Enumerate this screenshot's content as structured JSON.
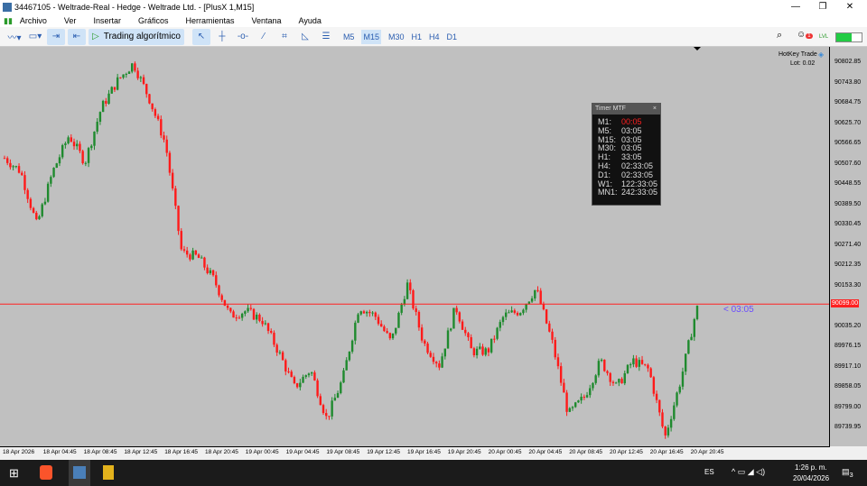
{
  "window": {
    "title": "34467105 - Weltrade-Real - Hedge - Weltrade Ltd. - [PlusX 1,M15]"
  },
  "menu": [
    "Archivo",
    "Ver",
    "Insertar",
    "Gráficos",
    "Herramientas",
    "Ventana",
    "Ayuda"
  ],
  "toolbar": {
    "algo_label": "Trading algorítmico",
    "timeframes": [
      "M5",
      "M15",
      "M30",
      "H1",
      "H4",
      "D1"
    ],
    "selected_timeframe": "M15",
    "notification_count": "1",
    "level_label": "LVL"
  },
  "hotkey": {
    "title": "HotKey Trade",
    "lot": "Lot: 0.02"
  },
  "timer": {
    "title": "Timer MTF",
    "close": "×",
    "rows": [
      [
        "M1:",
        "00:05"
      ],
      [
        "M5:",
        "03:05"
      ],
      [
        "M15:",
        "03:05"
      ],
      [
        "M30:",
        "03:05"
      ],
      [
        "H1:",
        "33:05"
      ],
      [
        "H4:",
        "02:33:05"
      ],
      [
        "D1:",
        "02:33:05"
      ],
      [
        "W1:",
        "122:33:05"
      ],
      [
        "MN1:",
        "242:33:05"
      ]
    ],
    "highlight_color": "#ff2020"
  },
  "countdown": "< 03:05",
  "price_axis": {
    "ticks": [
      "90802.85",
      "90743.80",
      "90684.75",
      "90625.70",
      "90566.65",
      "90507.60",
      "90448.55",
      "90389.50",
      "90330.45",
      "90271.40",
      "90212.35",
      "90153.30",
      "90094.25",
      "90035.20",
      "89976.15",
      "89917.10",
      "89858.05",
      "89799.00",
      "89739.95"
    ],
    "current_price": "90099.00"
  },
  "time_axis": [
    "18 Apr 2026",
    "18 Apr 04:45",
    "18 Apr 08:45",
    "18 Apr 12:45",
    "18 Apr 16:45",
    "18 Apr 20:45",
    "19 Apr 00:45",
    "19 Apr 04:45",
    "19 Apr 08:45",
    "19 Apr 12:45",
    "19 Apr 16:45",
    "19 Apr 20:45",
    "20 Apr 00:45",
    "20 Apr 04:45",
    "20 Apr 08:45",
    "20 Apr 12:45",
    "20 Apr 16:45",
    "20 Apr 20:45"
  ],
  "colors": {
    "bull": "#1f8a2e",
    "bear": "#ff1a1a",
    "background": "#c0c0c0",
    "price_line": "#ff2020",
    "countdown": "#6a4cff"
  },
  "price_path": [
    90524,
    90485,
    90328,
    90485,
    90590,
    90512,
    90669,
    90748,
    90800,
    90695,
    90564,
    90249,
    90236,
    90170,
    90065,
    90079,
    90052,
    89961,
    89856,
    89908,
    89764,
    89882,
    90092,
    90065,
    89987,
    90157,
    89987,
    89921,
    90092,
    89961,
    89961,
    90065,
    90079,
    90144,
    89987,
    89777,
    89829,
    89934,
    89856,
    89934,
    89908,
    89711,
    89882,
    90094
  ],
  "taskbar": {
    "lang": "ES",
    "time": "1:26 p. m.",
    "date": "20/04/2026",
    "notifications": "3"
  }
}
